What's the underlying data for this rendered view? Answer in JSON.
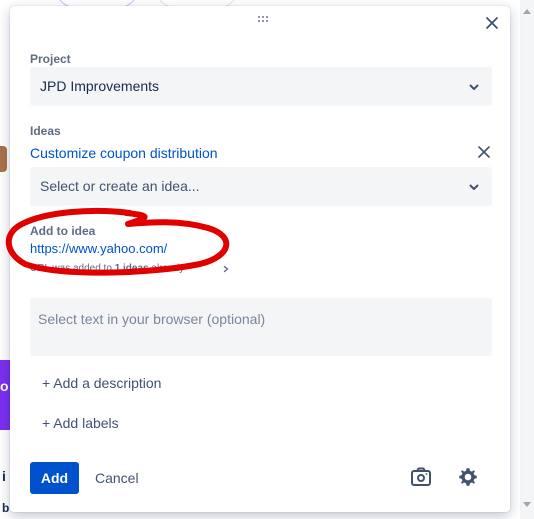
{
  "project": {
    "label": "Project",
    "selected": "JPD Improvements"
  },
  "ideas": {
    "label": "Ideas",
    "selected_idea": "Customize coupon distribution",
    "placeholder": "Select or create an idea..."
  },
  "add_to_idea": {
    "label": "Add to idea",
    "url": "https://www.yahoo.com/",
    "meta_prefix": "URL was added to",
    "meta_count": "1 ideas",
    "meta_suffix": "already"
  },
  "selection": {
    "placeholder": "Select text in your browser (optional)"
  },
  "actions": {
    "add_description": "+ Add a description",
    "add_labels": "+ Add labels",
    "add": "Add",
    "cancel": "Cancel"
  },
  "background": {
    "purple_char": "o",
    "left_char_1": "i",
    "left_char_2": "b"
  },
  "colors": {
    "primary": "#0052cc",
    "annotation": "#e00000",
    "field_bg": "#f4f5f7"
  },
  "icons": [
    "drag-handle-icon",
    "close-icon",
    "chevron-down-icon",
    "remove-icon",
    "chevron-right-icon",
    "camera-icon",
    "gear-icon"
  ]
}
